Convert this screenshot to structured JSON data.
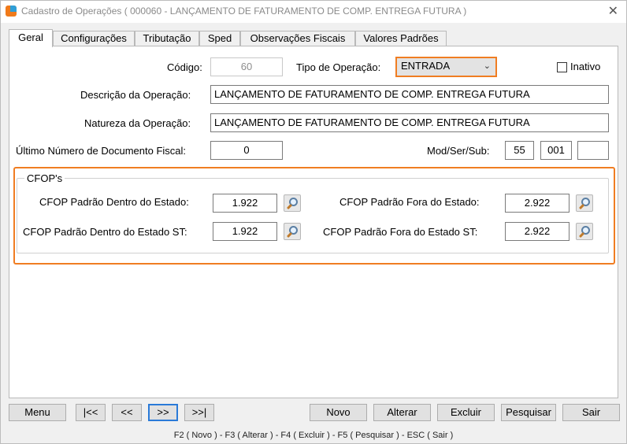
{
  "window": {
    "title": "Cadastro de Operações ( 000060 - LANÇAMENTO DE FATURAMENTO DE COMP. ENTREGA FUTURA )",
    "close_glyph": "✕"
  },
  "tabs": [
    {
      "label": "Geral"
    },
    {
      "label": "Configurações"
    },
    {
      "label": "Tributação"
    },
    {
      "label": "Sped"
    },
    {
      "label": "Observações Fiscais"
    },
    {
      "label": "Valores Padrões"
    }
  ],
  "form": {
    "codigo_label": "Código:",
    "codigo_value": "60",
    "tipo_label": "Tipo de Operação:",
    "tipo_value": "ENTRADA",
    "inativo_label": "Inativo",
    "descricao_label": "Descrição da Operação:",
    "descricao_value": "LANÇAMENTO DE FATURAMENTO DE COMP. ENTREGA FUTURA",
    "natureza_label": "Natureza da Operação:",
    "natureza_value": "LANÇAMENTO DE FATURAMENTO DE COMP. ENTREGA FUTURA",
    "ultimo_label": "Último Número de Documento Fiscal:",
    "ultimo_value": "0",
    "modsersub_label": "Mod/Ser/Sub:",
    "mod_value": "55",
    "ser_value": "001",
    "sub_value": ""
  },
  "cfop": {
    "group_title": "CFOP's",
    "dentro_label": "CFOP Padrão Dentro do Estado:",
    "dentro_value": "1.922",
    "fora_label": "CFOP Padrão Fora do Estado:",
    "fora_value": "2.922",
    "dentro_st_label": "CFOP Padrão Dentro do Estado ST:",
    "dentro_st_value": "1.922",
    "fora_st_label": "CFOP Padrão Fora do Estado ST:",
    "fora_st_value": "2.922"
  },
  "buttons": {
    "menu": "Menu",
    "first": "|<<",
    "prev": "<<",
    "next": ">>",
    "last": ">>|",
    "novo": "Novo",
    "alterar": "Alterar",
    "excluir": "Excluir",
    "pesquisar": "Pesquisar",
    "sair": "Sair"
  },
  "status_hint": "F2 ( Novo )  -  F3 ( Alterar )  -  F4 ( Excluir )  -  F5 ( Pesquisar )  -  ESC ( Sair )",
  "colors": {
    "highlight": "#f07d22",
    "focus": "#2a7ad8"
  }
}
